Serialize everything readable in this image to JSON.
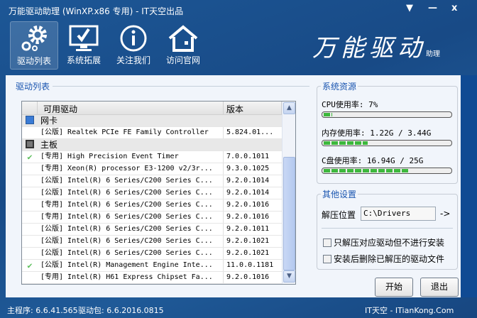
{
  "window": {
    "title": "万能驱动助理 (WinXP.x86 专用) - IT天空出品",
    "menu_icon": "▼",
    "minimize": "—",
    "close": "x"
  },
  "nav": [
    {
      "label": "驱动列表",
      "icon": "gears-icon"
    },
    {
      "label": "系统拓展",
      "icon": "monitor-check-icon"
    },
    {
      "label": "关注我们",
      "icon": "info-icon"
    },
    {
      "label": "访问官网",
      "icon": "home-icon"
    }
  ],
  "logo": {
    "text": "万能驱动",
    "sub": "助理"
  },
  "driver_list": {
    "section": "驱动列表",
    "col_driver": "可用驱动",
    "col_version": "版本",
    "rows": [
      {
        "type": "group",
        "name": "网卡",
        "icon": "network-icon"
      },
      {
        "type": "item",
        "name": "[公版] Realtek PCIe FE Family Controller",
        "version": "5.824.01...",
        "check": ""
      },
      {
        "type": "group",
        "name": "主板",
        "icon": "chip-icon"
      },
      {
        "type": "item",
        "name": "[专用] High Precision Event Timer",
        "version": "7.0.0.1011",
        "check": "✔"
      },
      {
        "type": "item",
        "name": "[专用] Xeon(R) processor E3-1200 v2/3r...",
        "version": "9.3.0.1025",
        "check": ""
      },
      {
        "type": "item",
        "name": "[公版] Intel(R) 6 Series/C200 Series C...",
        "version": "9.2.0.1014",
        "check": ""
      },
      {
        "type": "item",
        "name": "[公版] Intel(R) 6 Series/C200 Series C...",
        "version": "9.2.0.1014",
        "check": ""
      },
      {
        "type": "item",
        "name": "[专用] Intel(R) 6 Series/C200 Series C...",
        "version": "9.2.0.1016",
        "check": ""
      },
      {
        "type": "item",
        "name": "[专用] Intel(R) 6 Series/C200 Series C...",
        "version": "9.2.0.1016",
        "check": ""
      },
      {
        "type": "item",
        "name": "[公版] Intel(R) 6 Series/C200 Series C...",
        "version": "9.2.0.1011",
        "check": ""
      },
      {
        "type": "item",
        "name": "[公版] Intel(R) 6 Series/C200 Series C...",
        "version": "9.2.0.1021",
        "check": ""
      },
      {
        "type": "item",
        "name": "[公版] Intel(R) 6 Series/C200 Series C...",
        "version": "9.2.0.1021",
        "check": ""
      },
      {
        "type": "item",
        "name": "[公版] Intel(R) Management Engine Inte...",
        "version": "11.0.0.1181",
        "check": "✔"
      },
      {
        "type": "item",
        "name": "[专用] Intel(R) H61 Express Chipset Fa...",
        "version": "9.2.0.1016",
        "check": ""
      }
    ]
  },
  "resources": {
    "section": "系统资源",
    "cpu": {
      "label": "CPU使用率:  7%",
      "percent": 7
    },
    "mem": {
      "label": "内存使用率: 1.22G / 3.44G",
      "percent": 35
    },
    "disk": {
      "label": "C盘使用率:  16.94G / 25G",
      "percent": 68
    }
  },
  "settings": {
    "section": "其他设置",
    "extract_label": "解压位置",
    "extract_path": "C:\\Drivers",
    "arrow": "->",
    "opt1": "只解压对应驱动但不进行安装",
    "opt2": "安装后删除已解压的驱动文件"
  },
  "buttons": {
    "start": "开始",
    "exit": "退出"
  },
  "status": {
    "main": "主程序: 6.6.41.565",
    "pack": "驱动包: 6.6.2016.0815",
    "site": "IT天空 - ITianKong.Com"
  }
}
